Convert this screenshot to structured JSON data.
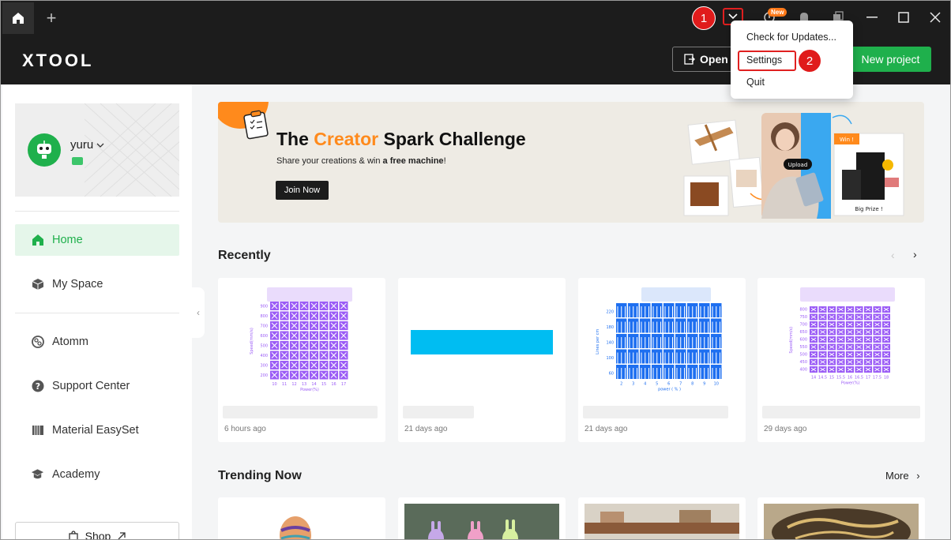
{
  "titlebar": {
    "new_badge": "New"
  },
  "header": {
    "logo": "XTOOL",
    "open_label": "Open",
    "new_project_label": "New project"
  },
  "menu": {
    "items": [
      "Check for Updates...",
      "Settings",
      "Quit"
    ]
  },
  "callouts": [
    "1",
    "2"
  ],
  "profile": {
    "username": "yuru"
  },
  "sidebar": {
    "items": [
      {
        "label": "Home",
        "icon": "home-icon",
        "active": true
      },
      {
        "label": "My Space",
        "icon": "cube-icon",
        "active": false
      },
      {
        "label": "Atomm",
        "icon": "atomm-icon",
        "active": false
      },
      {
        "label": "Support Center",
        "icon": "help-icon",
        "active": false
      },
      {
        "label": "Material EasySet",
        "icon": "material-icon",
        "active": false
      },
      {
        "label": "Academy",
        "icon": "academy-icon",
        "active": false
      }
    ],
    "shop_label": "Shop"
  },
  "banner": {
    "title_prefix": "The ",
    "title_accent": "Creator",
    "title_suffix": " Spark Challenge",
    "subtitle_prefix": "Share your creations & win ",
    "subtitle_bold": "a free machine",
    "subtitle_suffix": "!",
    "button_label": "Join Now",
    "art_labels": {
      "upload": "Upload",
      "win": "Win !",
      "big_prize": "Big Prize !"
    }
  },
  "recently": {
    "title": "Recently",
    "cards": [
      {
        "time": "6 hours ago",
        "kind": "grid-purple",
        "x_labels": [
          "10",
          "11",
          "12",
          "13",
          "14",
          "15",
          "16",
          "17"
        ],
        "y_labels": [
          "900",
          "800",
          "700",
          "600",
          "500",
          "400",
          "300",
          "200"
        ],
        "x_title": "Power(%)",
        "y_title": "Speed(mm/s)"
      },
      {
        "time": "21 days ago",
        "kind": "bar-cyan"
      },
      {
        "time": "21 days ago",
        "kind": "grid-blue",
        "x_labels": [
          "2",
          "3",
          "4",
          "5",
          "6",
          "7",
          "8",
          "9",
          "10"
        ],
        "y_labels": [
          "220",
          "180",
          "140",
          "100",
          "60"
        ],
        "x_title": "power ( % )",
        "y_title": "Lines per cm"
      },
      {
        "time": "29 days ago",
        "kind": "grid-purple2",
        "x_labels": [
          "14",
          "14.5",
          "15",
          "15.5",
          "16",
          "16.5",
          "17",
          "17.5",
          "18"
        ],
        "y_labels": [
          "800",
          "750",
          "700",
          "650",
          "600",
          "550",
          "500",
          "450",
          "400"
        ],
        "x_title": "Power(%)",
        "y_title": "Speed(mm/s)"
      }
    ]
  },
  "trending": {
    "title": "Trending Now",
    "more_label": "More"
  },
  "colors": {
    "brand_green": "#1fb04c",
    "accent_orange": "#ff8a1c",
    "annotation_red": "#e01b1b",
    "chart_purple": "#9b5cf6",
    "chart_blue": "#1e6ff0",
    "cyan_bar": "#00bdf2"
  }
}
